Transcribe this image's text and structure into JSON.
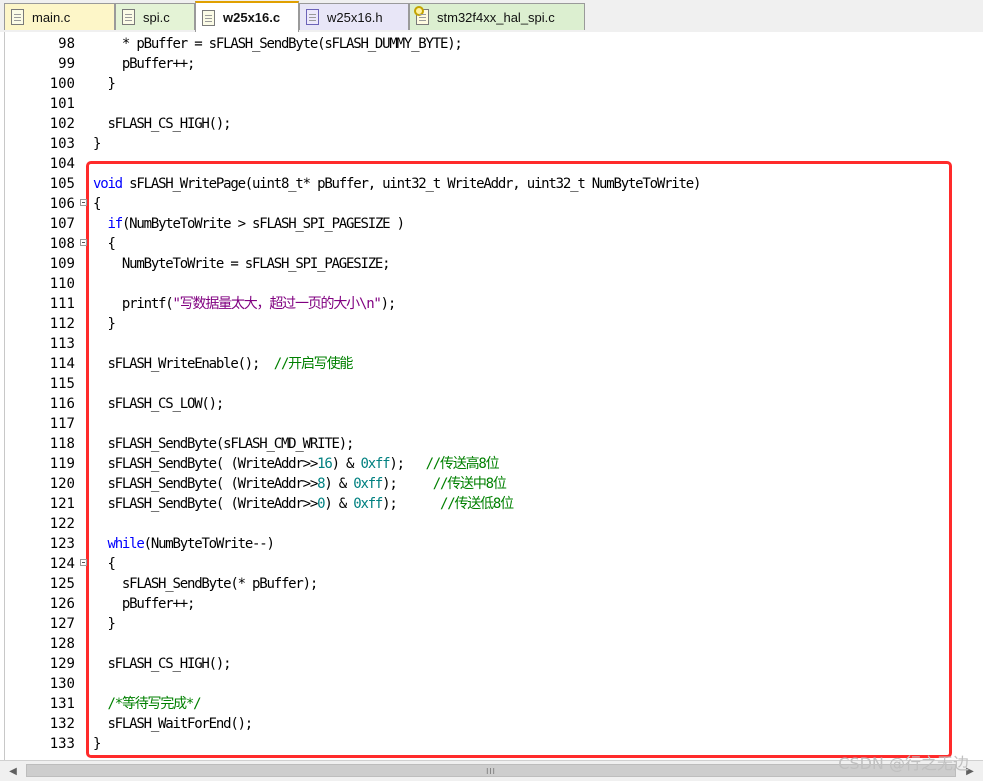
{
  "tabs": [
    {
      "label": "main.c",
      "type": "c",
      "active": false,
      "color": "#fdf6c8"
    },
    {
      "label": "spi.c",
      "type": "c",
      "active": false,
      "color": "#e4f3d6"
    },
    {
      "label": "w25x16.c",
      "type": "c",
      "active": true,
      "color": "#ffffff"
    },
    {
      "label": "w25x16.h",
      "type": "h",
      "active": false,
      "color": "#e8e6f7"
    },
    {
      "label": "stm32f4xx_hal_spi.c",
      "type": "key",
      "active": false,
      "color": "#dcefd0"
    }
  ],
  "editor": {
    "lines": [
      {
        "num": "98",
        "fold": false,
        "segs": [
          [
            "    * pBuffer = sFLASH_SendByte(sFLASH_DUMMY_BYTE);",
            ""
          ]
        ]
      },
      {
        "num": "99",
        "fold": false,
        "segs": [
          [
            "    pBuffer++;",
            ""
          ]
        ]
      },
      {
        "num": "100",
        "fold": false,
        "segs": [
          [
            "  }",
            ""
          ]
        ]
      },
      {
        "num": "101",
        "fold": false,
        "segs": []
      },
      {
        "num": "102",
        "fold": false,
        "segs": [
          [
            "  sFLASH_CS_HIGH();",
            ""
          ]
        ]
      },
      {
        "num": "103",
        "fold": false,
        "segs": [
          [
            "}",
            ""
          ]
        ]
      },
      {
        "num": "104",
        "fold": false,
        "segs": []
      },
      {
        "num": "105",
        "fold": false,
        "segs": [
          [
            "void",
            "kw"
          ],
          [
            " sFLASH_WritePage(uint8_t* pBuffer, uint32_t WriteAddr, uint32_t NumByteToWrite)",
            ""
          ]
        ]
      },
      {
        "num": "106",
        "fold": true,
        "segs": [
          [
            "{",
            ""
          ]
        ]
      },
      {
        "num": "107",
        "fold": false,
        "segs": [
          [
            "  ",
            ""
          ],
          [
            "if",
            "kw"
          ],
          [
            "(NumByteToWrite > sFLASH_SPI_PAGESIZE )",
            ""
          ]
        ]
      },
      {
        "num": "108",
        "fold": true,
        "segs": [
          [
            "  {",
            ""
          ]
        ]
      },
      {
        "num": "109",
        "fold": false,
        "segs": [
          [
            "    NumByteToWrite = sFLASH_SPI_PAGESIZE;",
            ""
          ]
        ]
      },
      {
        "num": "110",
        "fold": false,
        "segs": []
      },
      {
        "num": "111",
        "fold": false,
        "segs": [
          [
            "    printf(",
            ""
          ],
          [
            "\"写数据量太大，超过一页的大小\\n\"",
            "str"
          ],
          [
            ");",
            ""
          ]
        ]
      },
      {
        "num": "112",
        "fold": false,
        "segs": [
          [
            "  }",
            ""
          ]
        ]
      },
      {
        "num": "113",
        "fold": false,
        "segs": []
      },
      {
        "num": "114",
        "fold": false,
        "segs": [
          [
            "  sFLASH_WriteEnable();  ",
            ""
          ],
          [
            "//开启写使能",
            "cmt"
          ]
        ]
      },
      {
        "num": "115",
        "fold": false,
        "segs": []
      },
      {
        "num": "116",
        "fold": false,
        "segs": [
          [
            "  sFLASH_CS_LOW();",
            ""
          ]
        ]
      },
      {
        "num": "117",
        "fold": false,
        "segs": []
      },
      {
        "num": "118",
        "fold": false,
        "segs": [
          [
            "  sFLASH_SendByte(sFLASH_CMD_WRITE);",
            ""
          ]
        ]
      },
      {
        "num": "119",
        "fold": false,
        "segs": [
          [
            "  sFLASH_SendByte( (WriteAddr>>",
            ""
          ],
          [
            "16",
            "num"
          ],
          [
            ") & ",
            ""
          ],
          [
            "0xff",
            "num"
          ],
          [
            ");   ",
            ""
          ],
          [
            "//传送高8位",
            "cmt"
          ]
        ]
      },
      {
        "num": "120",
        "fold": false,
        "segs": [
          [
            "  sFLASH_SendByte( (WriteAddr>>",
            ""
          ],
          [
            "8",
            "num"
          ],
          [
            ") & ",
            ""
          ],
          [
            "0xff",
            "num"
          ],
          [
            ");     ",
            ""
          ],
          [
            "//传送中8位",
            "cmt"
          ]
        ]
      },
      {
        "num": "121",
        "fold": false,
        "segs": [
          [
            "  sFLASH_SendByte( (WriteAddr>>",
            ""
          ],
          [
            "0",
            "num"
          ],
          [
            ") & ",
            ""
          ],
          [
            "0xff",
            "num"
          ],
          [
            ");      ",
            ""
          ],
          [
            "//传送低8位",
            "cmt"
          ]
        ]
      },
      {
        "num": "122",
        "fold": false,
        "segs": []
      },
      {
        "num": "123",
        "fold": false,
        "segs": [
          [
            "  ",
            ""
          ],
          [
            "while",
            "kw"
          ],
          [
            "(NumByteToWrite--)",
            ""
          ]
        ]
      },
      {
        "num": "124",
        "fold": true,
        "segs": [
          [
            "  {",
            ""
          ]
        ]
      },
      {
        "num": "125",
        "fold": false,
        "segs": [
          [
            "    sFLASH_SendByte(* pBuffer);",
            ""
          ]
        ]
      },
      {
        "num": "126",
        "fold": false,
        "segs": [
          [
            "    pBuffer++;",
            ""
          ]
        ]
      },
      {
        "num": "127",
        "fold": false,
        "segs": [
          [
            "  }",
            ""
          ]
        ]
      },
      {
        "num": "128",
        "fold": false,
        "segs": []
      },
      {
        "num": "129",
        "fold": false,
        "segs": [
          [
            "  sFLASH_CS_HIGH();",
            ""
          ]
        ]
      },
      {
        "num": "130",
        "fold": false,
        "segs": []
      },
      {
        "num": "131",
        "fold": false,
        "segs": [
          [
            "  ",
            ""
          ],
          [
            "/*等待写完成*/",
            "cmt"
          ]
        ]
      },
      {
        "num": "132",
        "fold": false,
        "segs": [
          [
            "  sFLASH_WaitForEnd();",
            ""
          ]
        ]
      },
      {
        "num": "133",
        "fold": false,
        "segs": [
          [
            "}",
            ""
          ]
        ]
      }
    ]
  },
  "scrollbar": {
    "left_arrow": "◀",
    "right_arrow": "▶",
    "grip": "III"
  },
  "watermark": "CSDN @行之无边",
  "colors": {
    "keyword": "#0000ff",
    "string": "#800080",
    "number": "#008080",
    "comment": "#008000",
    "highlight_box": "#ff2a2a"
  }
}
